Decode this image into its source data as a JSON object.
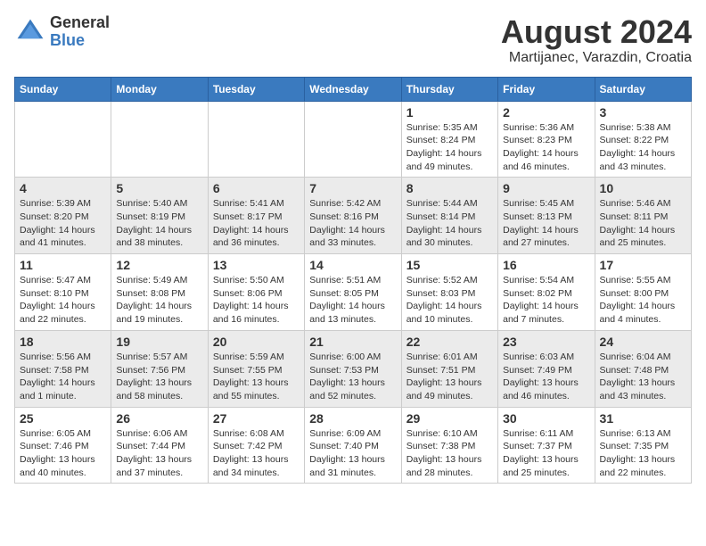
{
  "header": {
    "logo_general": "General",
    "logo_blue": "Blue",
    "month_year": "August 2024",
    "location": "Martijanec, Varazdin, Croatia"
  },
  "calendar": {
    "days_of_week": [
      "Sunday",
      "Monday",
      "Tuesday",
      "Wednesday",
      "Thursday",
      "Friday",
      "Saturday"
    ],
    "weeks": [
      {
        "days": [
          {
            "number": "",
            "info": ""
          },
          {
            "number": "",
            "info": ""
          },
          {
            "number": "",
            "info": ""
          },
          {
            "number": "",
            "info": ""
          },
          {
            "number": "1",
            "info": "Sunrise: 5:35 AM\nSunset: 8:24 PM\nDaylight: 14 hours and 49 minutes."
          },
          {
            "number": "2",
            "info": "Sunrise: 5:36 AM\nSunset: 8:23 PM\nDaylight: 14 hours and 46 minutes."
          },
          {
            "number": "3",
            "info": "Sunrise: 5:38 AM\nSunset: 8:22 PM\nDaylight: 14 hours and 43 minutes."
          }
        ]
      },
      {
        "days": [
          {
            "number": "4",
            "info": "Sunrise: 5:39 AM\nSunset: 8:20 PM\nDaylight: 14 hours and 41 minutes."
          },
          {
            "number": "5",
            "info": "Sunrise: 5:40 AM\nSunset: 8:19 PM\nDaylight: 14 hours and 38 minutes."
          },
          {
            "number": "6",
            "info": "Sunrise: 5:41 AM\nSunset: 8:17 PM\nDaylight: 14 hours and 36 minutes."
          },
          {
            "number": "7",
            "info": "Sunrise: 5:42 AM\nSunset: 8:16 PM\nDaylight: 14 hours and 33 minutes."
          },
          {
            "number": "8",
            "info": "Sunrise: 5:44 AM\nSunset: 8:14 PM\nDaylight: 14 hours and 30 minutes."
          },
          {
            "number": "9",
            "info": "Sunrise: 5:45 AM\nSunset: 8:13 PM\nDaylight: 14 hours and 27 minutes."
          },
          {
            "number": "10",
            "info": "Sunrise: 5:46 AM\nSunset: 8:11 PM\nDaylight: 14 hours and 25 minutes."
          }
        ]
      },
      {
        "days": [
          {
            "number": "11",
            "info": "Sunrise: 5:47 AM\nSunset: 8:10 PM\nDaylight: 14 hours and 22 minutes."
          },
          {
            "number": "12",
            "info": "Sunrise: 5:49 AM\nSunset: 8:08 PM\nDaylight: 14 hours and 19 minutes."
          },
          {
            "number": "13",
            "info": "Sunrise: 5:50 AM\nSunset: 8:06 PM\nDaylight: 14 hours and 16 minutes."
          },
          {
            "number": "14",
            "info": "Sunrise: 5:51 AM\nSunset: 8:05 PM\nDaylight: 14 hours and 13 minutes."
          },
          {
            "number": "15",
            "info": "Sunrise: 5:52 AM\nSunset: 8:03 PM\nDaylight: 14 hours and 10 minutes."
          },
          {
            "number": "16",
            "info": "Sunrise: 5:54 AM\nSunset: 8:02 PM\nDaylight: 14 hours and 7 minutes."
          },
          {
            "number": "17",
            "info": "Sunrise: 5:55 AM\nSunset: 8:00 PM\nDaylight: 14 hours and 4 minutes."
          }
        ]
      },
      {
        "days": [
          {
            "number": "18",
            "info": "Sunrise: 5:56 AM\nSunset: 7:58 PM\nDaylight: 14 hours and 1 minute."
          },
          {
            "number": "19",
            "info": "Sunrise: 5:57 AM\nSunset: 7:56 PM\nDaylight: 13 hours and 58 minutes."
          },
          {
            "number": "20",
            "info": "Sunrise: 5:59 AM\nSunset: 7:55 PM\nDaylight: 13 hours and 55 minutes."
          },
          {
            "number": "21",
            "info": "Sunrise: 6:00 AM\nSunset: 7:53 PM\nDaylight: 13 hours and 52 minutes."
          },
          {
            "number": "22",
            "info": "Sunrise: 6:01 AM\nSunset: 7:51 PM\nDaylight: 13 hours and 49 minutes."
          },
          {
            "number": "23",
            "info": "Sunrise: 6:03 AM\nSunset: 7:49 PM\nDaylight: 13 hours and 46 minutes."
          },
          {
            "number": "24",
            "info": "Sunrise: 6:04 AM\nSunset: 7:48 PM\nDaylight: 13 hours and 43 minutes."
          }
        ]
      },
      {
        "days": [
          {
            "number": "25",
            "info": "Sunrise: 6:05 AM\nSunset: 7:46 PM\nDaylight: 13 hours and 40 minutes."
          },
          {
            "number": "26",
            "info": "Sunrise: 6:06 AM\nSunset: 7:44 PM\nDaylight: 13 hours and 37 minutes."
          },
          {
            "number": "27",
            "info": "Sunrise: 6:08 AM\nSunset: 7:42 PM\nDaylight: 13 hours and 34 minutes."
          },
          {
            "number": "28",
            "info": "Sunrise: 6:09 AM\nSunset: 7:40 PM\nDaylight: 13 hours and 31 minutes."
          },
          {
            "number": "29",
            "info": "Sunrise: 6:10 AM\nSunset: 7:38 PM\nDaylight: 13 hours and 28 minutes."
          },
          {
            "number": "30",
            "info": "Sunrise: 6:11 AM\nSunset: 7:37 PM\nDaylight: 13 hours and 25 minutes."
          },
          {
            "number": "31",
            "info": "Sunrise: 6:13 AM\nSunset: 7:35 PM\nDaylight: 13 hours and 22 minutes."
          }
        ]
      }
    ]
  }
}
